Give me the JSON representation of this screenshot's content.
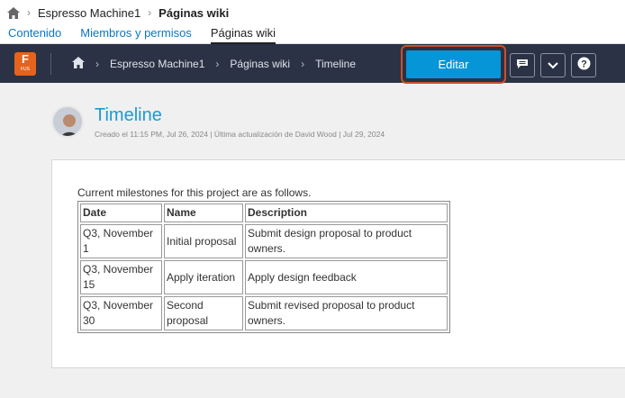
{
  "topbar": {
    "home_icon": "home-icon",
    "project": "Espresso Machine1",
    "current": "Páginas wiki"
  },
  "tabs": [
    {
      "label": "Contenido"
    },
    {
      "label": "Miembros y permisos"
    },
    {
      "label": "Páginas wiki"
    }
  ],
  "appbar": {
    "logo_letter": "F",
    "logo_sub": "FUS",
    "crumbs": [
      "Espresso Machine1",
      "Páginas wiki",
      "Timeline"
    ],
    "edit_label": "Editar",
    "icons": [
      "comment-icon",
      "chevron-down-icon",
      "help-icon"
    ]
  },
  "page": {
    "title": "Timeline",
    "meta": "Creado el 11:15 PM, Jul 26, 2024 | Última actualización de David Wood | Jul 29, 2024",
    "intro": "Current milestones for this project are as follows.",
    "table": {
      "headers": [
        "Date",
        "Name",
        "Description"
      ],
      "rows": [
        [
          "Q3, November 1",
          "Initial proposal",
          "Submit design proposal to product owners."
        ],
        [
          "Q3, November 15",
          "Apply iteration",
          "Apply design feedback"
        ],
        [
          "Q3, November 30",
          "Second proposal",
          "Submit revised proposal to product owners."
        ]
      ]
    }
  },
  "colors": {
    "appbar_bg": "#2b3245",
    "accent": "#0696d7",
    "link": "#0b76c3",
    "highlight": "#c8512a",
    "logo": "#e5631c"
  }
}
